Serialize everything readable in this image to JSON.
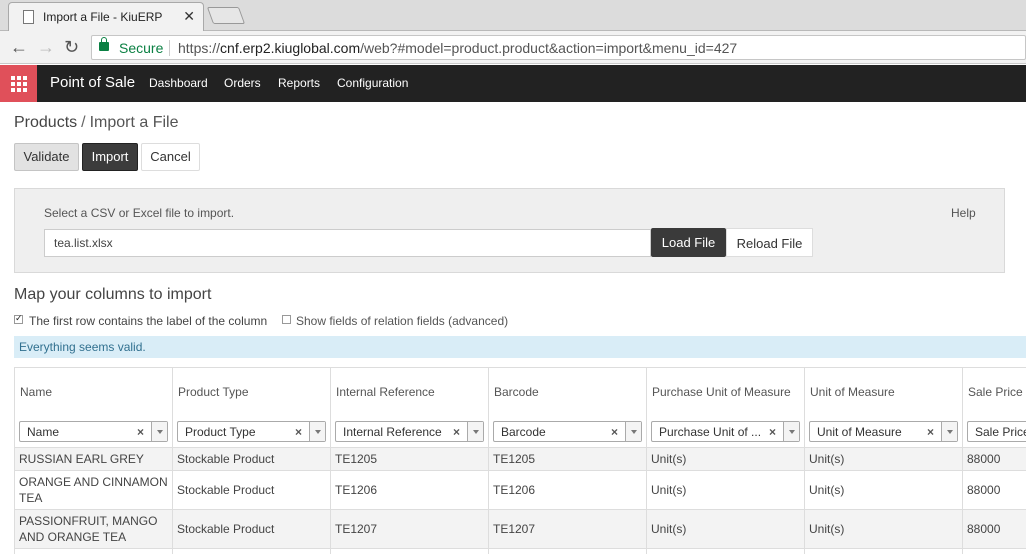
{
  "browser": {
    "tab_title": "Import a File - KiuERP",
    "secure_label": "Secure",
    "url_scheme": "https://",
    "url_host": "cnf.erp2.kiuglobal.com",
    "url_path": "/web?#model=product.product&action=import&menu_id=427"
  },
  "app": {
    "brand": "Point of Sale",
    "menu": [
      "Dashboard",
      "Orders",
      "Reports",
      "Configuration"
    ]
  },
  "breadcrumb": {
    "parent": "Products",
    "separator": "/",
    "current": "Import a File"
  },
  "actions": {
    "validate": "Validate",
    "import": "Import",
    "cancel": "Cancel"
  },
  "file_panel": {
    "label": "Select a CSV or Excel file to import.",
    "help": "Help",
    "file_name": "tea.list.xlsx",
    "load": "Load File",
    "reload": "Reload File"
  },
  "mapping": {
    "title": "Map your columns to import",
    "first_row_label": "The first row contains the label of the column",
    "first_row_checked": true,
    "show_relation_label": "Show fields of relation fields (advanced)",
    "show_relation_checked": false,
    "valid_message": "Everything seems valid."
  },
  "table": {
    "headers": [
      "Name",
      "Product Type",
      "Internal Reference",
      "Barcode",
      "Purchase Unit of Measure",
      "Unit of Measure",
      "Sale Price"
    ],
    "selects": [
      "Name",
      "Product Type",
      "Internal Reference",
      "Barcode",
      "Purchase Unit of ...",
      "Unit of Measure",
      "Sale Price"
    ],
    "rows": [
      [
        "RUSSIAN EARL GREY",
        "Stockable Product",
        "TE1205",
        "TE1205",
        "Unit(s)",
        "Unit(s)",
        "88000"
      ],
      [
        "ORANGE AND CINNAMON TEA",
        "Stockable Product",
        "TE1206",
        "TE1206",
        "Unit(s)",
        "Unit(s)",
        "88000"
      ],
      [
        "PASSIONFRUIT, MANGO AND ORANGE TEA",
        "Stockable Product",
        "TE1207",
        "TE1207",
        "Unit(s)",
        "Unit(s)",
        "88000"
      ]
    ]
  }
}
